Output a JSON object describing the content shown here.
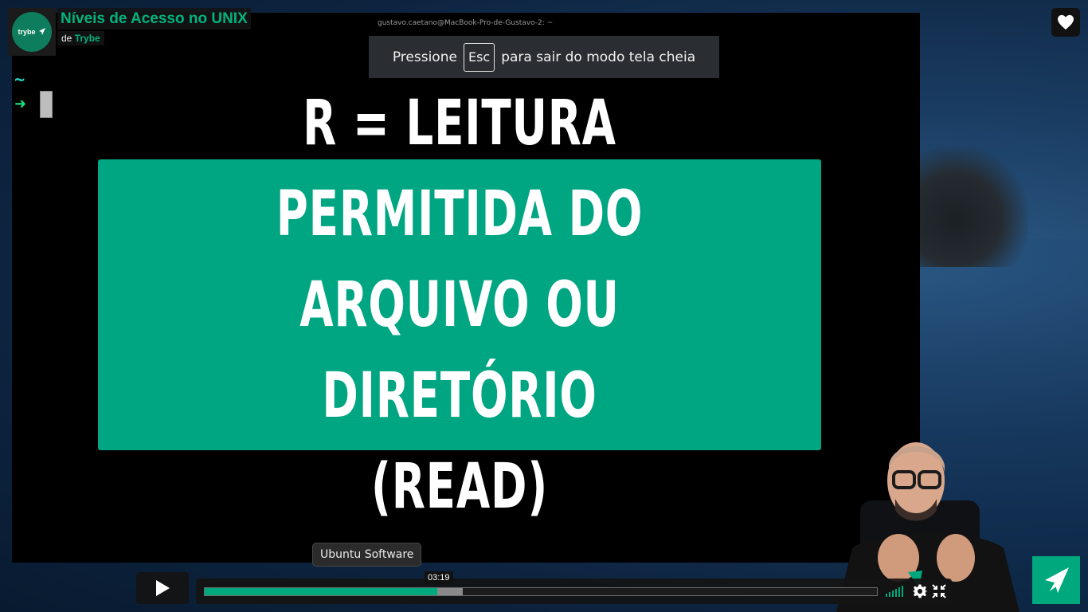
{
  "video": {
    "title": "Níveis de Acesso no UNIX",
    "byline_prefix": "de",
    "author": "Trybe",
    "channel_logo_text": "trybe"
  },
  "terminal": {
    "window_title": "gustavo.caetano@MacBook-Pro-de-Gustavo-2: ~",
    "prompt_tilde": "~",
    "prompt_arrow": "➜"
  },
  "fullscreen_notice": {
    "before": "Pressione",
    "key": "Esc",
    "after": "para sair do modo tela cheia"
  },
  "slide": {
    "lines": [
      "R = LEITURA PERMITIDA DO",
      "ARQUIVO OU DIRETÓRIO",
      "(READ)"
    ],
    "background": "#00a582"
  },
  "player": {
    "tooltip": "Ubuntu Software",
    "current_time": "03:19",
    "played_fraction": 0.346,
    "buffered_fraction": 0.384,
    "accent_color": "#00a97d"
  },
  "icons": {
    "like": "heart-icon",
    "play": "play-icon",
    "settings": "gear-icon",
    "fullscreen": "fullscreen-exit-icon",
    "volume": "volume-icon",
    "brand": "trybe-logo-icon"
  }
}
